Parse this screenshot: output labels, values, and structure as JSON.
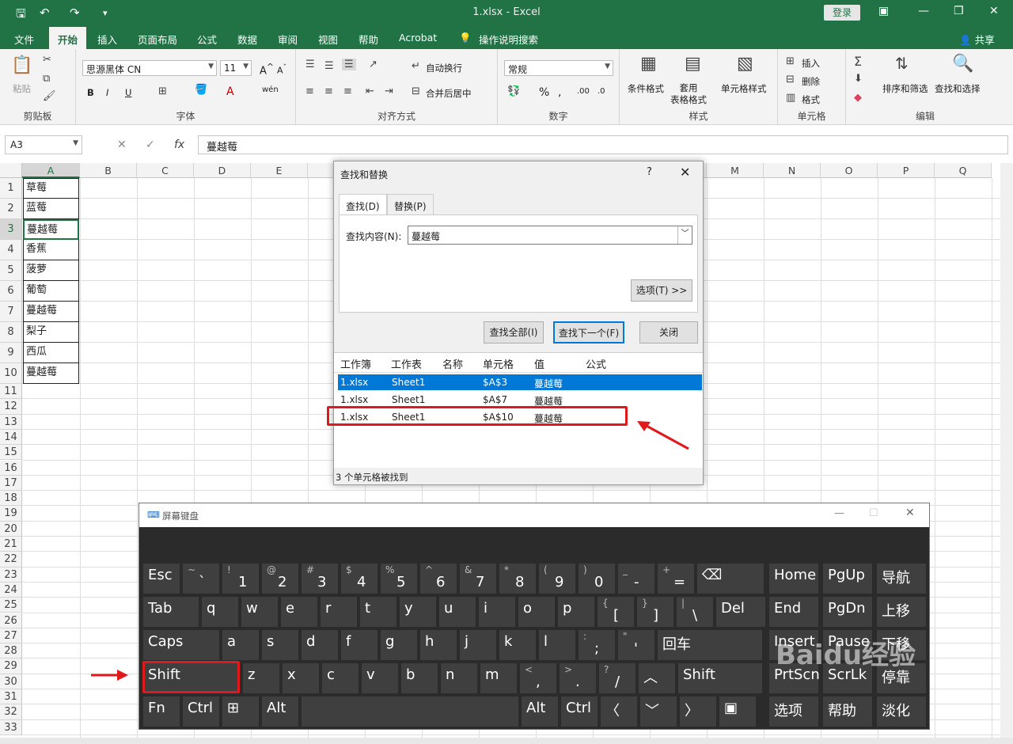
{
  "titlebar": {
    "title": "1.xlsx  -  Excel",
    "login": "登录"
  },
  "tabs": [
    "文件",
    "开始",
    "插入",
    "页面布局",
    "公式",
    "数据",
    "审阅",
    "视图",
    "帮助",
    "Acrobat",
    "操作说明搜索"
  ],
  "share": "共享",
  "ribbon": {
    "clipboard": {
      "paste": "粘贴",
      "group": "剪贴板"
    },
    "font": {
      "name": "思源黑体 CN",
      "size": "11",
      "group": "字体"
    },
    "align": {
      "wrap": "自动换行",
      "merge": "合并后居中",
      "group": "对齐方式"
    },
    "number": {
      "format": "常规",
      "group": "数字"
    },
    "styles": {
      "cond": "条件格式",
      "table": "套用\n表格格式",
      "cell": "单元格样式",
      "group": "样式"
    },
    "cells": {
      "insert": "插入",
      "delete": "删除",
      "format": "格式",
      "group": "单元格"
    },
    "editing": {
      "sort": "排序和筛选",
      "find": "查找和选择",
      "group": "编辑"
    }
  },
  "formula": {
    "namebox": "A3",
    "content": "蔓越莓"
  },
  "columns": [
    "A",
    "B",
    "C",
    "D",
    "E",
    "F",
    "G",
    "H",
    "I",
    "J",
    "K",
    "L",
    "M",
    "N",
    "O",
    "P",
    "Q"
  ],
  "rows": [
    "1",
    "2",
    "3",
    "4",
    "5",
    "6",
    "7",
    "8",
    "9",
    "10",
    "11",
    "12",
    "13",
    "14",
    "15",
    "16",
    "17",
    "18",
    "19",
    "20",
    "21",
    "22",
    "23",
    "24",
    "25",
    "26",
    "27",
    "28",
    "29",
    "30",
    "31",
    "32",
    "33"
  ],
  "cells": [
    "草莓",
    "蓝莓",
    "蔓越莓",
    "香蕉",
    "菠萝",
    "葡萄",
    "蔓越莓",
    "梨子",
    "西瓜",
    "蔓越莓"
  ],
  "dialog": {
    "title": "查找和替换",
    "help": "?",
    "tab_find": "查找(D)",
    "tab_replace": "替换(P)",
    "find_label": "查找内容(N):",
    "find_value": "蔓越莓",
    "options": "选项(T) >>",
    "find_all": "查找全部(I)",
    "find_next": "查找下一个(F)",
    "close": "关闭",
    "headers": [
      "工作簿",
      "工作表",
      "名称",
      "单元格",
      "值",
      "公式"
    ],
    "results": [
      {
        "book": "1.xlsx",
        "sheet": "Sheet1",
        "cell": "$A$3",
        "value": "蔓越莓"
      },
      {
        "book": "1.xlsx",
        "sheet": "Sheet1",
        "cell": "$A$7",
        "value": "蔓越莓"
      },
      {
        "book": "1.xlsx",
        "sheet": "Sheet1",
        "cell": "$A$10",
        "value": "蔓越莓"
      }
    ],
    "status": "3 个单元格被找到"
  },
  "osk": {
    "title": "屏幕键盘",
    "row1": [
      [
        "Esc",
        ""
      ],
      [
        "~",
        "`"
      ],
      [
        "!",
        "1"
      ],
      [
        "@",
        "2"
      ],
      [
        "#",
        "3"
      ],
      [
        "$",
        "4"
      ],
      [
        "%",
        "5"
      ],
      [
        "^",
        "6"
      ],
      [
        "&",
        "7"
      ],
      [
        "*",
        "8"
      ],
      [
        "(",
        "9"
      ],
      [
        ")",
        "0"
      ],
      [
        "_",
        "-"
      ],
      [
        "+",
        "="
      ],
      [
        "⌫",
        ""
      ]
    ],
    "row2": [
      "Tab",
      "q",
      "w",
      "e",
      "r",
      "t",
      "y",
      "u",
      "i",
      "o",
      "p",
      "{ [",
      "} ]",
      "| \\",
      "Del"
    ],
    "row3": [
      "Caps",
      "a",
      "s",
      "d",
      "f",
      "g",
      "h",
      "j",
      "k",
      "l",
      ": ;",
      "\" '",
      "回车"
    ],
    "row4": [
      "Shift",
      "z",
      "x",
      "c",
      "v",
      "b",
      "n",
      "m",
      "< ,",
      "> .",
      "? /",
      "︿",
      "Shift"
    ],
    "row5": [
      "Fn",
      "Ctrl",
      "⊞",
      "Alt",
      "",
      "Alt",
      "Ctrl",
      "〈",
      "﹀",
      "〉",
      "▣"
    ],
    "nav": [
      "Home",
      "PgUp",
      "导航",
      "End",
      "PgDn",
      "上移",
      "Insert",
      "Pause",
      "下移",
      "PrtScn",
      "ScrLk",
      "停靠",
      "选项",
      "帮助",
      "淡化"
    ]
  },
  "watermark": "Baidu经验",
  "colors": {
    "excel_green": "#217346",
    "selection_blue": "#0078d7",
    "annotation_red": "#e0191d"
  }
}
